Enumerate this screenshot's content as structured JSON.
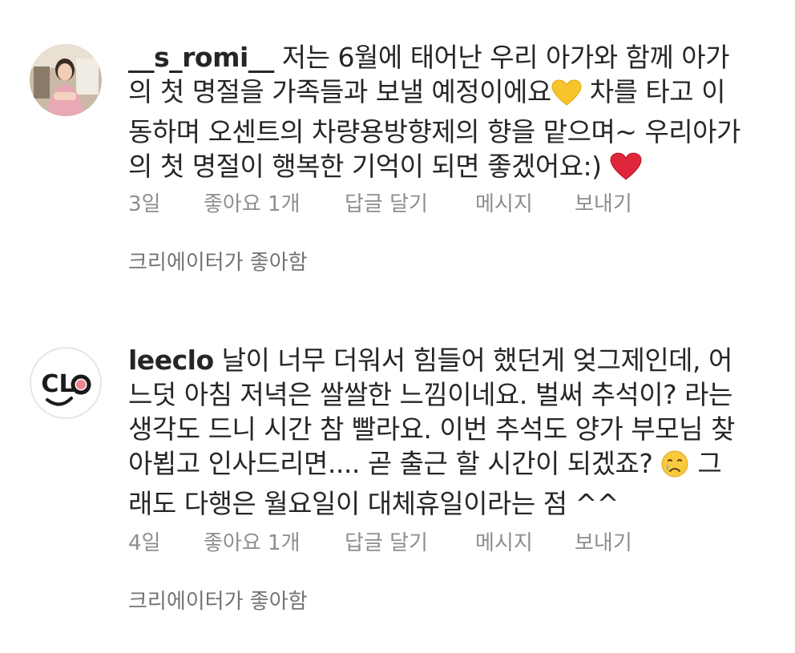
{
  "comments": [
    {
      "username": "__s_romi__",
      "avatar": "profile-photo-woman",
      "text_lines": [
        " 저는 6월에 태어난 우리 아가와 함께 아가",
        "의 첫 명절을 가족들과 보낼 예정이에요",
        " 차를 타고 이",
        "동하며 오센트의 차량용방향제의 향을 맡으며~ 우리아가",
        "의 첫 명절이 행복한 기억이 되면 좋겠어요:)"
      ],
      "emojis": [
        "yellow-heart-icon",
        "red-heart-icon"
      ],
      "time": "3일",
      "likes": "좋아요 1개",
      "reply": "답글 달기",
      "message": "메시지",
      "send": "보내기",
      "creator_liked": "크리에이터가 좋아함"
    },
    {
      "username": "leeclo",
      "avatar_logo_text": "CLO",
      "text_lines": [
        " 날이 너무 더워서 힘들어 했던게 엊그제인데, 어",
        "느덧 아침 저녁은 쌀쌀한 느낌이네요. 벌써 추석이? 라는",
        "생각도 드니 시간 참 빨라요. 이번 추석도 양가 부모님 찾",
        "아뵙고 인사드리면.... 곧 출근 할 시간이 되겠죠?",
        " 그",
        "래도 다행은 월요일이 대체휴일이라는 점 ^^"
      ],
      "emojis": [
        "crying-face-icon"
      ],
      "time": "4일",
      "likes": "좋아요 1개",
      "reply": "답글 달기",
      "message": "메시지",
      "send": "보내기",
      "creator_liked": "크리에이터가 좋아함"
    }
  ],
  "colors": {
    "text": "#262626",
    "meta": "#8e8e8e",
    "red_heart": "#e0263a",
    "yellow_heart": "#f7c52b"
  }
}
